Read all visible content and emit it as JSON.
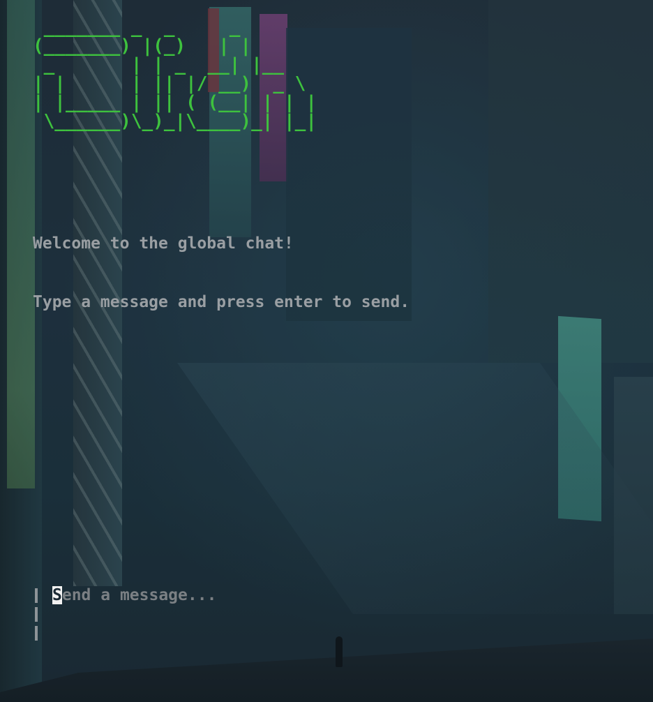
{
  "app": {
    "logo_ascii": " _______ _  _     _\n(_______) |(_)   | |\n _       | | _  __| |__\n| |      | || |/ __)  _ \\\n| |_____ | || ( (__| | | |\n \\______)\\_)_|\\____)_| |_|"
  },
  "welcome": {
    "line1": "Welcome to the global chat!",
    "line2": "Type a message and press enter to send."
  },
  "input": {
    "placeholder_cursor_char": "S",
    "placeholder_rest": "end a message..."
  },
  "colors": {
    "logo": "#3ec23e",
    "text": "#9a9fa3",
    "placeholder": "#7b8084",
    "cursor": "#f2f2f2"
  }
}
